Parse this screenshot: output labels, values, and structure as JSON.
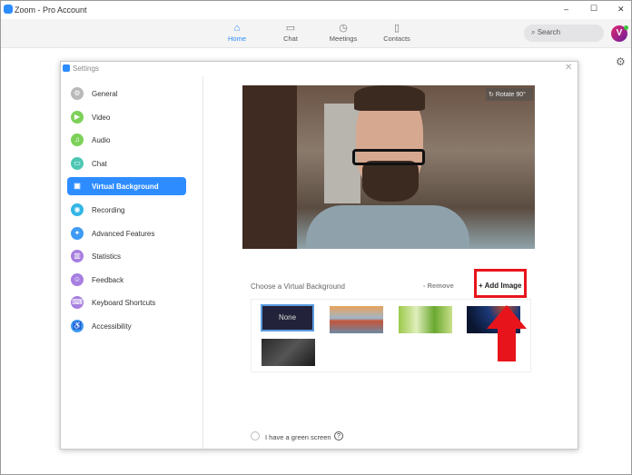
{
  "window": {
    "title": "Zoom - Pro Account",
    "minimize": "–",
    "maximize": "☐",
    "close": "✕"
  },
  "nav": {
    "items": [
      {
        "label": "Home",
        "icon": "home-icon",
        "active": true
      },
      {
        "label": "Chat",
        "icon": "chat-icon"
      },
      {
        "label": "Meetings",
        "icon": "clock-icon"
      },
      {
        "label": "Contacts",
        "icon": "contacts-icon"
      }
    ],
    "search_placeholder": "Search",
    "avatar": "V"
  },
  "settings": {
    "title": "Settings",
    "close": "✕",
    "sidebar": [
      {
        "label": "General",
        "color": "#b9b9b9",
        "glyph": "⚙"
      },
      {
        "label": "Video",
        "color": "#7dd15a",
        "glyph": "▶"
      },
      {
        "label": "Audio",
        "color": "#7dd15a",
        "glyph": "♫"
      },
      {
        "label": "Chat",
        "color": "#4ec7b5",
        "glyph": "▭"
      },
      {
        "label": "Virtual Background",
        "color": "#2d8cff",
        "glyph": "▣",
        "active": true
      },
      {
        "label": "Recording",
        "color": "#32b6e6",
        "glyph": "◉"
      },
      {
        "label": "Advanced Features",
        "color": "#3d9af5",
        "glyph": "✦"
      },
      {
        "label": "Statistics",
        "color": "#a77fe0",
        "glyph": "▥"
      },
      {
        "label": "Feedback",
        "color": "#a77fe0",
        "glyph": "☺"
      },
      {
        "label": "Keyboard Shortcuts",
        "color": "#a77fe0",
        "glyph": "⌨"
      },
      {
        "label": "Accessibility",
        "color": "#3d9af5",
        "glyph": "♿"
      }
    ],
    "rotate_label": "Rotate 90°",
    "choose_label": "Choose a Virtual Background",
    "remove_label": "Remove",
    "add_image_label": "Add Image",
    "none_label": "None",
    "green_screen_label": "I have a green screen",
    "help": "?"
  },
  "colors": {
    "accent": "#2d8cff",
    "highlight": "#e8141b"
  }
}
